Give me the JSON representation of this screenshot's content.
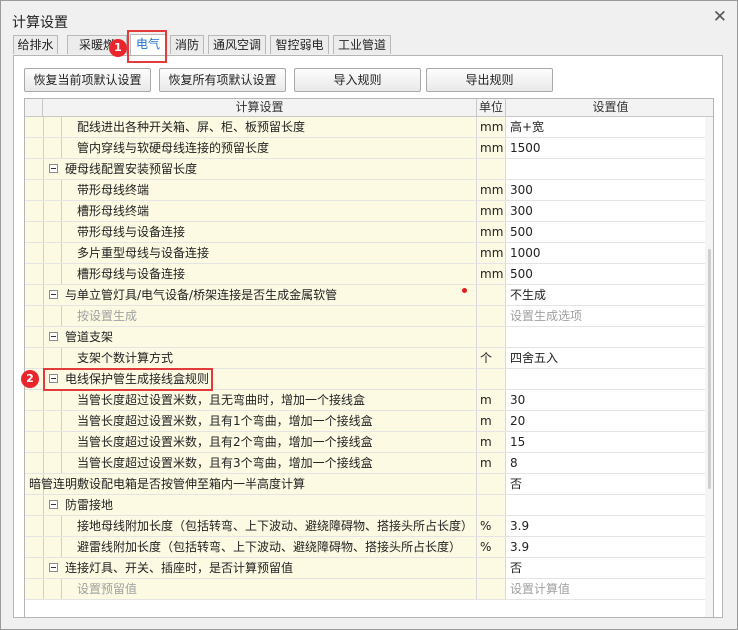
{
  "dialog": {
    "title": "计算设置",
    "close": "✕"
  },
  "tabs": [
    "给排水",
    "采暖燃",
    "电气",
    "消防",
    "通风空调",
    "智控弱电",
    "工业管道"
  ],
  "active_tab": "电气",
  "buttons": [
    "恢复当前项默认设置",
    "恢复所有项默认设置",
    "导入规则",
    "导出规则"
  ],
  "columns": [
    "计算设置",
    "单位",
    "设置值"
  ],
  "annotations": {
    "badge1": "1",
    "badge2": "2",
    "accent": "#e8262c"
  },
  "rows": [
    {
      "name": "配线进出各种开关箱、屏、柜、板预留长度",
      "unit": "mm",
      "value": "高+宽",
      "level": 2
    },
    {
      "name": "管内穿线与软硬母线连接的预留长度",
      "unit": "mm",
      "value": "1500",
      "level": 2
    },
    {
      "name": "硬母线配置安装预留长度",
      "unit": "",
      "value": "",
      "level": 1,
      "group": true
    },
    {
      "name": "带形母线终端",
      "unit": "mm",
      "value": "300",
      "level": 2
    },
    {
      "name": "槽形母线终端",
      "unit": "mm",
      "value": "300",
      "level": 2
    },
    {
      "name": "带形母线与设备连接",
      "unit": "mm",
      "value": "500",
      "level": 2
    },
    {
      "name": "多片重型母线与设备连接",
      "unit": "mm",
      "value": "1000",
      "level": 2
    },
    {
      "name": "槽形母线与设备连接",
      "unit": "mm",
      "value": "500",
      "level": 2
    },
    {
      "name": "与单立管灯具/电气设备/桥架连接是否生成金属软管",
      "unit": "",
      "value": "不生成",
      "level": 1,
      "group": true
    },
    {
      "name": "按设置生成",
      "unit": "",
      "value": "设置生成选项",
      "level": 2,
      "muted": true
    },
    {
      "name": "管道支架",
      "unit": "",
      "value": "",
      "level": 1,
      "group": true
    },
    {
      "name": "支架个数计算方式",
      "unit": "个",
      "value": "四舍五入",
      "level": 2
    },
    {
      "name": "电线保护管生成接线盒规则",
      "unit": "",
      "value": "",
      "level": 1,
      "group": true
    },
    {
      "name": "当管长度超过设置米数，且无弯曲时，增加一个接线盒",
      "unit": "m",
      "value": "30",
      "level": 2
    },
    {
      "name": "当管长度超过设置米数，且有1个弯曲，增加一个接线盒",
      "unit": "m",
      "value": "20",
      "level": 2
    },
    {
      "name": "当管长度超过设置米数，且有2个弯曲，增加一个接线盒",
      "unit": "m",
      "value": "15",
      "level": 2
    },
    {
      "name": "当管长度超过设置米数，且有3个弯曲，增加一个接线盒",
      "unit": "m",
      "value": "8",
      "level": 2
    },
    {
      "name": "暗管连明敷设配电箱是否按管伸至箱内一半高度计算",
      "unit": "",
      "value": "否",
      "level": 0
    },
    {
      "name": "防雷接地",
      "unit": "",
      "value": "",
      "level": 1,
      "group": true
    },
    {
      "name": "接地母线附加长度（包括转弯、上下波动、避绕障碍物、搭接头所占长度）",
      "unit": "%",
      "value": "3.9",
      "level": 2
    },
    {
      "name": "避雷线附加长度（包括转弯、上下波动、避绕障碍物、搭接头所占长度）",
      "unit": "%",
      "value": "3.9",
      "level": 2
    },
    {
      "name": "连接灯具、开关、插座时，是否计算预留值",
      "unit": "",
      "value": "否",
      "level": 1,
      "group": true
    },
    {
      "name": "设置预留值",
      "unit": "",
      "value": "设置计算值",
      "level": 2,
      "muted": true
    }
  ]
}
